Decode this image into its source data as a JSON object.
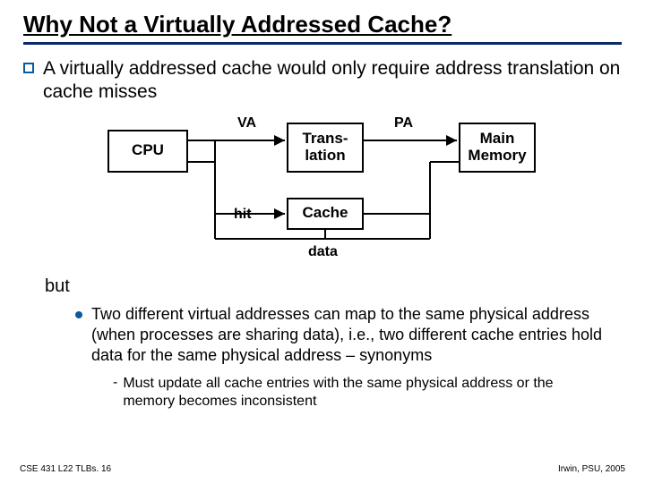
{
  "title": "Why Not a Virtually Addressed Cache?",
  "main_bullet": "A virtually addressed cache would only require address translation on cache misses",
  "diagram": {
    "cpu": "CPU",
    "translation": "Trans-\nlation",
    "main_memory": "Main\nMemory",
    "cache": "Cache",
    "va": "VA",
    "pa": "PA",
    "hit": "hit",
    "data": "data"
  },
  "but_label": "but",
  "sub_bullet": "Two different virtual addresses can map to the same physical address (when processes are sharing data), i.e., two different cache entries hold data for the same physical address – synonyms",
  "dash_bullet": "Must update all cache entries with the same physical address or the memory becomes inconsistent",
  "footer_left": "CSE 431  L22 TLBs. 16",
  "footer_right": "Irwin, PSU, 2005"
}
